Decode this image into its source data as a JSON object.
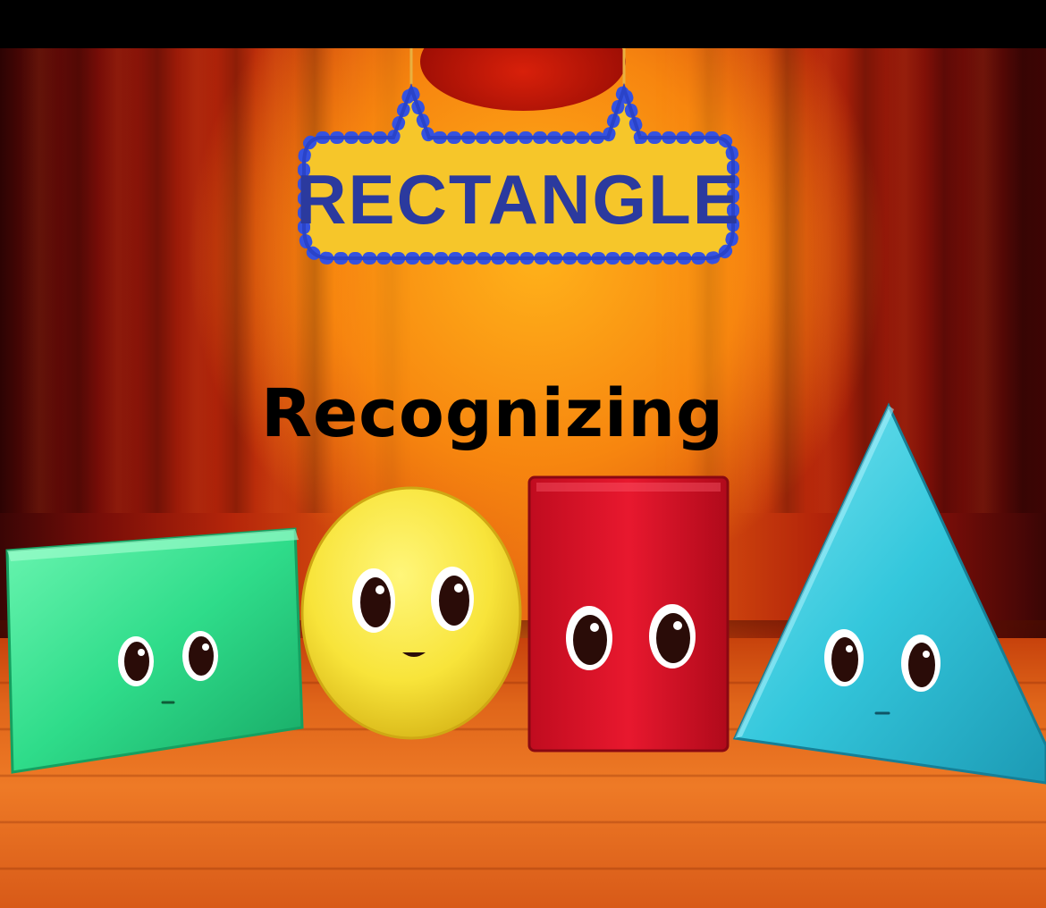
{
  "scene": {
    "sign_text": "RECTANGLE",
    "caption": "Recognizing",
    "characters": [
      "green-rectangle",
      "yellow-circle",
      "red-rectangle",
      "blue-triangle"
    ],
    "colors": {
      "sign_text": "#2b3a9e",
      "sign_bulbs": "#3552e0",
      "sign_fill": "#f6c62a",
      "green": "#2fdc8a",
      "yellow": "#f8e43a",
      "red": "#e0132a",
      "cyan": "#34c7dc"
    }
  }
}
